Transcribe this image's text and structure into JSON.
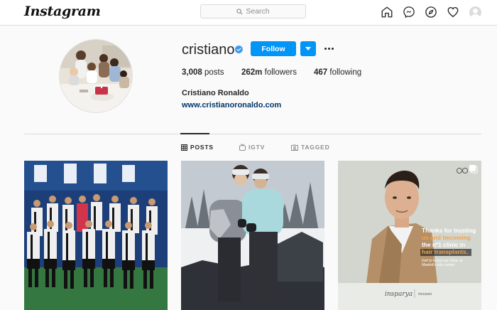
{
  "brand": {
    "logo_text": "Instagram"
  },
  "search": {
    "placeholder": "Search"
  },
  "nav": {
    "icons": [
      "home-icon",
      "messenger-icon",
      "explore-icon",
      "heart-icon",
      "profile-avatar"
    ]
  },
  "profile": {
    "username": "cristiano",
    "verified": true,
    "follow_label": "Follow",
    "stats": {
      "posts_count": "3,008",
      "posts_label": "posts",
      "followers_count": "262m",
      "followers_label": "followers",
      "following_count": "467",
      "following_label": "following"
    },
    "full_name": "Cristiano Ronaldo",
    "website": "www.cristianoronaldo.com"
  },
  "tabs": [
    {
      "label": "POSTS",
      "icon": "grid-icon",
      "active": true
    },
    {
      "label": "IGTV",
      "icon": "igtv-icon",
      "active": false
    },
    {
      "label": "TAGGED",
      "icon": "tagged-icon",
      "active": false
    }
  ],
  "posts": [
    {
      "type": "team-photo"
    },
    {
      "type": "couple-snow"
    },
    {
      "type": "ad",
      "ad_text_1": "Thanks for trusting",
      "ad_text_2": "us and becoming",
      "ad_text_3": "the nº1 clinic in",
      "ad_text_4": "hair transplants.",
      "ad_text_5": "Get to know our clinic at",
      "ad_text_6": "Madrid's city center.",
      "brand": "insparya",
      "brand_small": "mnosam"
    }
  ],
  "colors": {
    "accent": "#0095f6",
    "link": "#00376b",
    "border": "#dbdbdb",
    "ad_highlight": "#f3a34a"
  }
}
